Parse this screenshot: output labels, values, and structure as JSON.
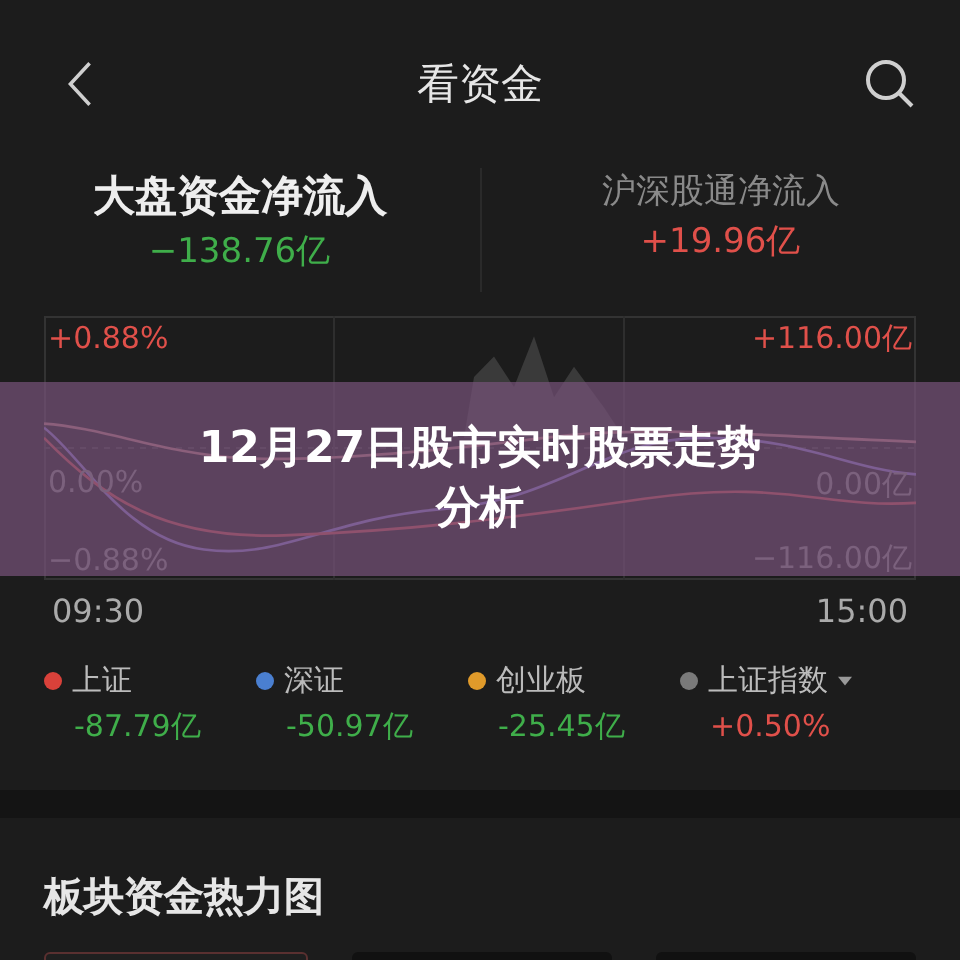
{
  "header": {
    "title": "看资金"
  },
  "flows": [
    {
      "label": "大盘资金净流入",
      "value": "−138.76亿",
      "kind": "down",
      "selected": true
    },
    {
      "label": "沪深股通净流入",
      "value": "+19.96亿",
      "kind": "up",
      "selected": false
    }
  ],
  "chart": {
    "left_labels": [
      {
        "text": "+0.88%",
        "kind": "up"
      },
      {
        "text": "0.00%",
        "kind": "flat"
      },
      {
        "text": "−0.88%",
        "kind": "flat"
      }
    ],
    "right_labels": [
      {
        "text": "+116.00亿",
        "kind": "up"
      },
      {
        "text": "0.00亿",
        "kind": "flat"
      },
      {
        "text": "−116.00亿",
        "kind": "flat"
      }
    ],
    "start_time": "09:30",
    "end_time": "15:00"
  },
  "legend": [
    {
      "name": "上证",
      "value": "-87.79亿",
      "color": "#d9413a",
      "kind": "down",
      "dropdown": false
    },
    {
      "name": "深证",
      "value": "-50.97亿",
      "color": "#4a7fd0",
      "kind": "down",
      "dropdown": false
    },
    {
      "name": "创业板",
      "value": "-25.45亿",
      "color": "#e09a2a",
      "kind": "down",
      "dropdown": false
    },
    {
      "name": "上证指数",
      "value": "+0.50%",
      "color": "#7a7a7a",
      "kind": "up",
      "dropdown": true
    }
  ],
  "section": {
    "title": "板块资金热力图"
  },
  "banner": {
    "title": "12月27日股市实时股票走势分析"
  }
}
